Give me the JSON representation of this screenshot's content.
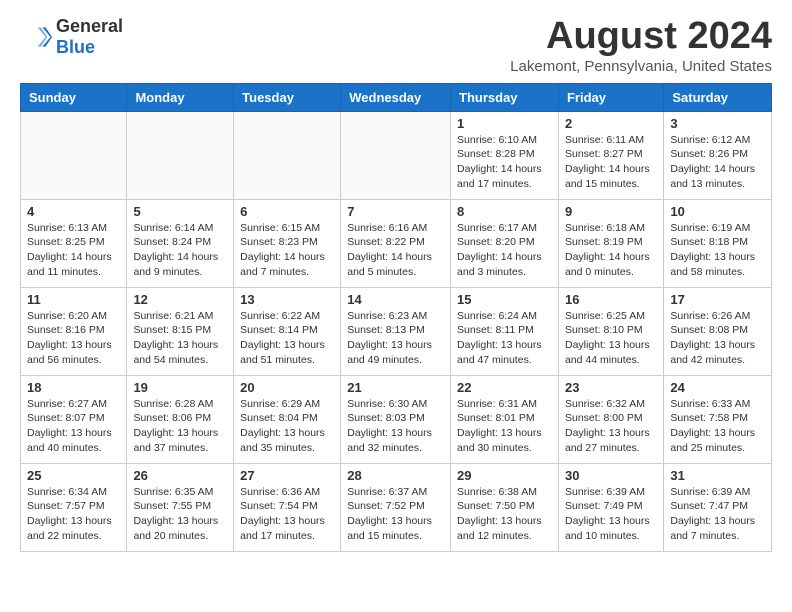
{
  "header": {
    "logo_general": "General",
    "logo_blue": "Blue",
    "month_year": "August 2024",
    "location": "Lakemont, Pennsylvania, United States"
  },
  "days_of_week": [
    "Sunday",
    "Monday",
    "Tuesday",
    "Wednesday",
    "Thursday",
    "Friday",
    "Saturday"
  ],
  "weeks": [
    [
      {
        "day": "",
        "info": ""
      },
      {
        "day": "",
        "info": ""
      },
      {
        "day": "",
        "info": ""
      },
      {
        "day": "",
        "info": ""
      },
      {
        "day": "1",
        "info": "Sunrise: 6:10 AM\nSunset: 8:28 PM\nDaylight: 14 hours\nand 17 minutes."
      },
      {
        "day": "2",
        "info": "Sunrise: 6:11 AM\nSunset: 8:27 PM\nDaylight: 14 hours\nand 15 minutes."
      },
      {
        "day": "3",
        "info": "Sunrise: 6:12 AM\nSunset: 8:26 PM\nDaylight: 14 hours\nand 13 minutes."
      }
    ],
    [
      {
        "day": "4",
        "info": "Sunrise: 6:13 AM\nSunset: 8:25 PM\nDaylight: 14 hours\nand 11 minutes."
      },
      {
        "day": "5",
        "info": "Sunrise: 6:14 AM\nSunset: 8:24 PM\nDaylight: 14 hours\nand 9 minutes."
      },
      {
        "day": "6",
        "info": "Sunrise: 6:15 AM\nSunset: 8:23 PM\nDaylight: 14 hours\nand 7 minutes."
      },
      {
        "day": "7",
        "info": "Sunrise: 6:16 AM\nSunset: 8:22 PM\nDaylight: 14 hours\nand 5 minutes."
      },
      {
        "day": "8",
        "info": "Sunrise: 6:17 AM\nSunset: 8:20 PM\nDaylight: 14 hours\nand 3 minutes."
      },
      {
        "day": "9",
        "info": "Sunrise: 6:18 AM\nSunset: 8:19 PM\nDaylight: 14 hours\nand 0 minutes."
      },
      {
        "day": "10",
        "info": "Sunrise: 6:19 AM\nSunset: 8:18 PM\nDaylight: 13 hours\nand 58 minutes."
      }
    ],
    [
      {
        "day": "11",
        "info": "Sunrise: 6:20 AM\nSunset: 8:16 PM\nDaylight: 13 hours\nand 56 minutes."
      },
      {
        "day": "12",
        "info": "Sunrise: 6:21 AM\nSunset: 8:15 PM\nDaylight: 13 hours\nand 54 minutes."
      },
      {
        "day": "13",
        "info": "Sunrise: 6:22 AM\nSunset: 8:14 PM\nDaylight: 13 hours\nand 51 minutes."
      },
      {
        "day": "14",
        "info": "Sunrise: 6:23 AM\nSunset: 8:13 PM\nDaylight: 13 hours\nand 49 minutes."
      },
      {
        "day": "15",
        "info": "Sunrise: 6:24 AM\nSunset: 8:11 PM\nDaylight: 13 hours\nand 47 minutes."
      },
      {
        "day": "16",
        "info": "Sunrise: 6:25 AM\nSunset: 8:10 PM\nDaylight: 13 hours\nand 44 minutes."
      },
      {
        "day": "17",
        "info": "Sunrise: 6:26 AM\nSunset: 8:08 PM\nDaylight: 13 hours\nand 42 minutes."
      }
    ],
    [
      {
        "day": "18",
        "info": "Sunrise: 6:27 AM\nSunset: 8:07 PM\nDaylight: 13 hours\nand 40 minutes."
      },
      {
        "day": "19",
        "info": "Sunrise: 6:28 AM\nSunset: 8:06 PM\nDaylight: 13 hours\nand 37 minutes."
      },
      {
        "day": "20",
        "info": "Sunrise: 6:29 AM\nSunset: 8:04 PM\nDaylight: 13 hours\nand 35 minutes."
      },
      {
        "day": "21",
        "info": "Sunrise: 6:30 AM\nSunset: 8:03 PM\nDaylight: 13 hours\nand 32 minutes."
      },
      {
        "day": "22",
        "info": "Sunrise: 6:31 AM\nSunset: 8:01 PM\nDaylight: 13 hours\nand 30 minutes."
      },
      {
        "day": "23",
        "info": "Sunrise: 6:32 AM\nSunset: 8:00 PM\nDaylight: 13 hours\nand 27 minutes."
      },
      {
        "day": "24",
        "info": "Sunrise: 6:33 AM\nSunset: 7:58 PM\nDaylight: 13 hours\nand 25 minutes."
      }
    ],
    [
      {
        "day": "25",
        "info": "Sunrise: 6:34 AM\nSunset: 7:57 PM\nDaylight: 13 hours\nand 22 minutes."
      },
      {
        "day": "26",
        "info": "Sunrise: 6:35 AM\nSunset: 7:55 PM\nDaylight: 13 hours\nand 20 minutes."
      },
      {
        "day": "27",
        "info": "Sunrise: 6:36 AM\nSunset: 7:54 PM\nDaylight: 13 hours\nand 17 minutes."
      },
      {
        "day": "28",
        "info": "Sunrise: 6:37 AM\nSunset: 7:52 PM\nDaylight: 13 hours\nand 15 minutes."
      },
      {
        "day": "29",
        "info": "Sunrise: 6:38 AM\nSunset: 7:50 PM\nDaylight: 13 hours\nand 12 minutes."
      },
      {
        "day": "30",
        "info": "Sunrise: 6:39 AM\nSunset: 7:49 PM\nDaylight: 13 hours\nand 10 minutes."
      },
      {
        "day": "31",
        "info": "Sunrise: 6:39 AM\nSunset: 7:47 PM\nDaylight: 13 hours\nand 7 minutes."
      }
    ]
  ]
}
